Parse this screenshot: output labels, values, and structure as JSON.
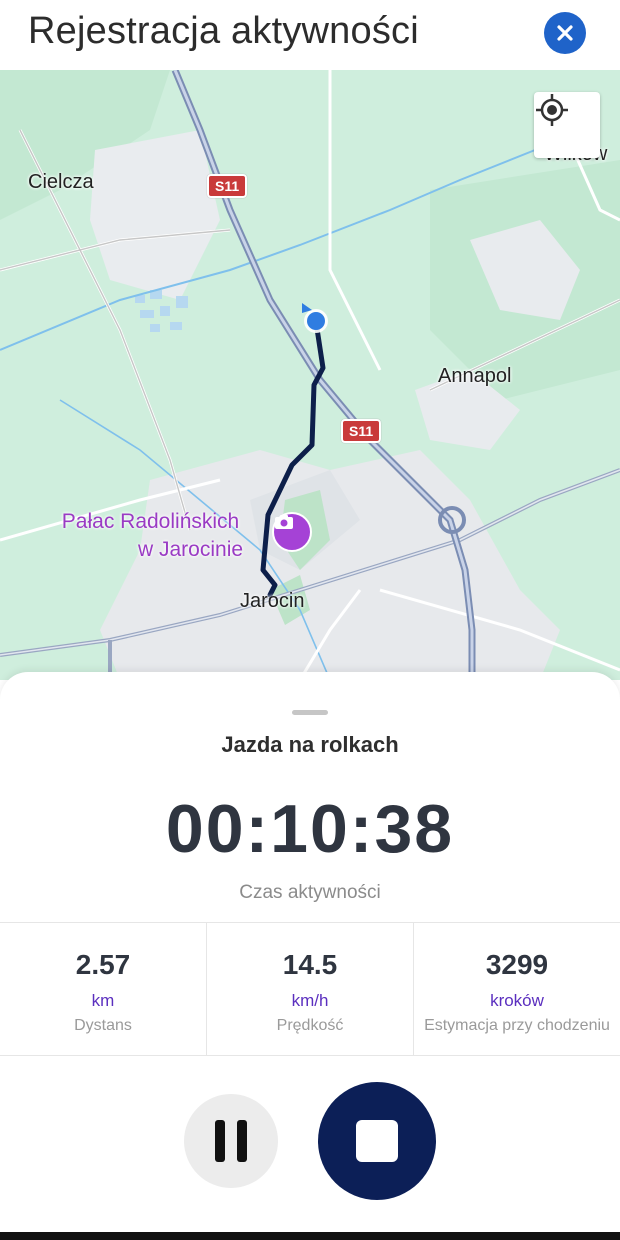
{
  "header": {
    "title": "Rejestracja aktywności",
    "close_icon": "close-icon"
  },
  "map": {
    "places": {
      "cielcza": "Cielcza",
      "wilkow": "Wilków",
      "annapol": "Annapol",
      "jarocin": "Jarocin"
    },
    "poi": {
      "line1": "Pałac Radolińskich",
      "line2": "w Jarocinie",
      "icon": "camera-icon"
    },
    "road_shields": [
      "S11",
      "S11"
    ],
    "locate_icon": "crosshair-icon"
  },
  "activity": {
    "type": "Jazda na rolkach",
    "timer": "00:10:38",
    "timer_label": "Czas aktywności"
  },
  "stats": [
    {
      "value": "2.57",
      "unit": "km",
      "label": "Dystans"
    },
    {
      "value": "14.5",
      "unit": "km/h",
      "label": "Prędkość"
    },
    {
      "value": "3299",
      "unit": "kroków",
      "label": "Estymacja przy chodzeniu"
    }
  ],
  "controls": {
    "pause_icon": "pause-icon",
    "stop_icon": "stop-icon"
  },
  "colors": {
    "accent": "#1f63c9",
    "stop_button": "#0c1f57",
    "unit_text": "#5b2fbf",
    "route": "#0d1f4a",
    "poi": "#9a3bc4"
  }
}
